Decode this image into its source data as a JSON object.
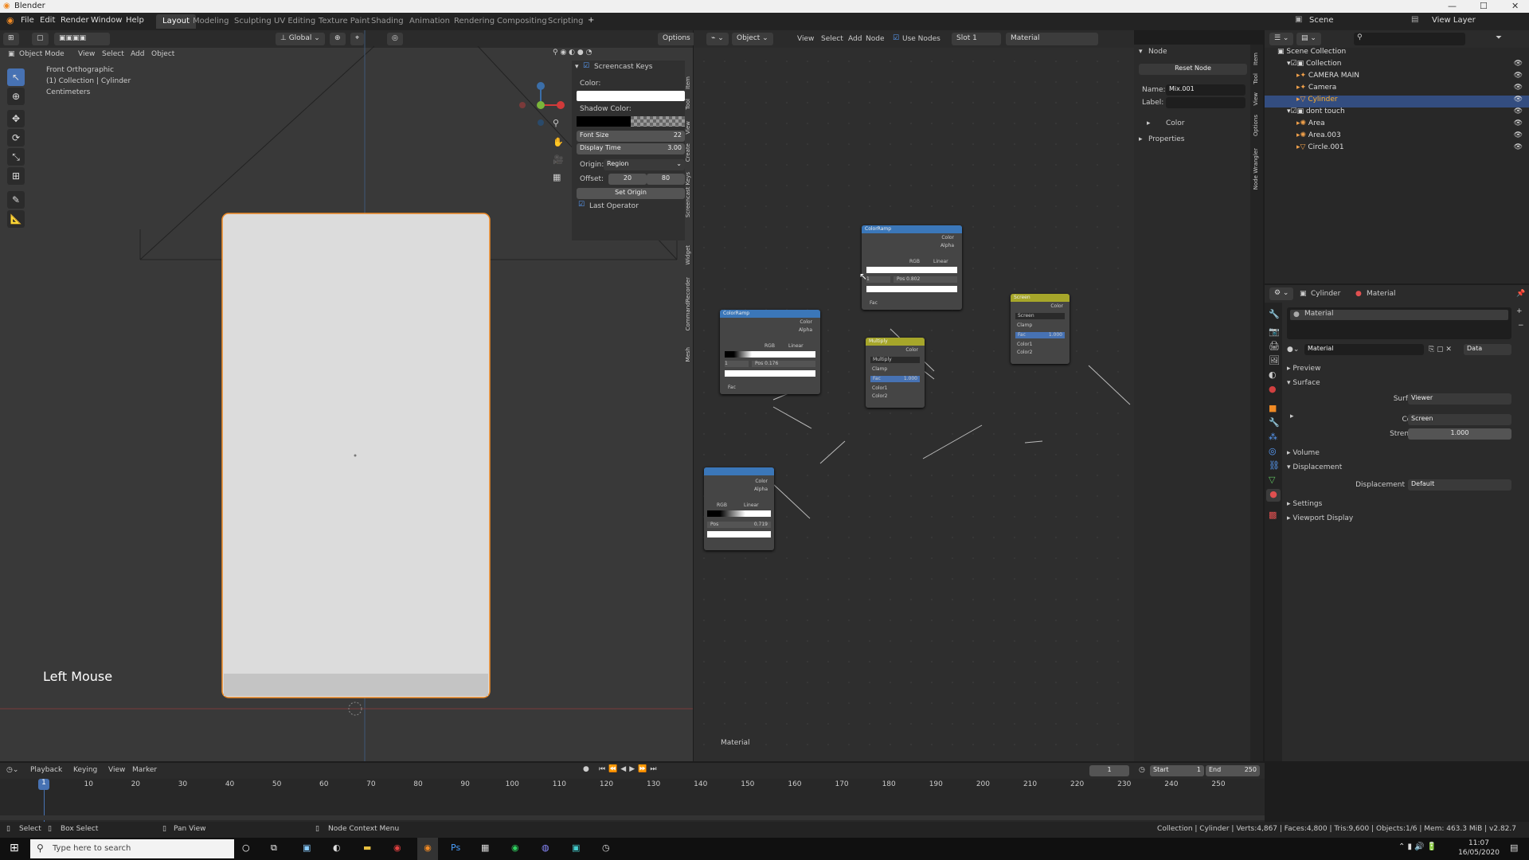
{
  "window": {
    "title": "Blender",
    "minimize": "—",
    "maximize": "☐",
    "close": "✕"
  },
  "menu": {
    "items": [
      "File",
      "Edit",
      "Render",
      "Window",
      "Help"
    ],
    "workspaces": [
      "Layout",
      "Modeling",
      "Sculpting",
      "UV Editing",
      "Texture Paint",
      "Shading",
      "Animation",
      "Rendering",
      "Compositing",
      "Scripting"
    ],
    "add": "+",
    "scene": "Scene",
    "view_layer": "View Layer"
  },
  "viewport": {
    "mode": "Object Mode",
    "menus": [
      "View",
      "Select",
      "Add",
      "Object"
    ],
    "orientation": "Global",
    "options": "Options",
    "info": [
      "Front Orthographic",
      "(1) Collection | Cylinder",
      "Centimeters"
    ],
    "overlay_text": "Left Mouse"
  },
  "screencast": {
    "title": "Screencast Keys",
    "color_label": "Color:",
    "shadow_label": "Shadow Color:",
    "font_size_label": "Font Size",
    "font_size": "22",
    "display_time_label": "Display Time",
    "display_time": "3.00",
    "origin_label": "Origin:",
    "origin": "Region",
    "offset_label": "Offset:",
    "offset_x": "20",
    "offset_y": "80",
    "set_origin": "Set Origin",
    "last_operator": "Last Operator"
  },
  "sidebar_tabs_vp": [
    "Item",
    "Tool",
    "View",
    "Create",
    "Screencast Keys",
    "Widget",
    "CommandRecorder",
    "Mesh"
  ],
  "node_editor": {
    "menus": [
      "Object",
      "View",
      "Select",
      "Add",
      "Node"
    ],
    "use_nodes": "Use Nodes",
    "slot": "Slot 1",
    "material": "Material",
    "footer": "Material",
    "nodes": {
      "cr1": {
        "title": "ColorRamp",
        "out": [
          "Color",
          "Alpha"
        ],
        "mode": "RGB",
        "interp": "Linear",
        "idx": "1",
        "pos_label": "Pos",
        "pos": "0.802",
        "fac": "Fac"
      },
      "cr2": {
        "title": "ColorRamp",
        "out": [
          "Color",
          "Alpha"
        ],
        "mode": "RGB",
        "interp": "Linear",
        "idx": "1",
        "pos_label": "Pos",
        "pos": "0.176",
        "fac": "Fac"
      },
      "cr3": {
        "out": [
          "Color",
          "Alpha"
        ],
        "mode": "RGB",
        "interp": "Linear",
        "pos_label": "Pos",
        "pos": "0.719"
      },
      "mul": {
        "title": "Multiply",
        "out": "Color",
        "mode": "Multiply",
        "clamp": "Clamp",
        "fac_label": "Fac",
        "fac": "1.000",
        "in": [
          "Color1",
          "Color2"
        ]
      },
      "scr": {
        "title": "Screen",
        "out": "Color",
        "mode": "Screen",
        "clamp": "Clamp",
        "fac_label": "Fac",
        "fac": "1.000",
        "in": [
          "Color1",
          "Color2"
        ]
      }
    }
  },
  "npanel": {
    "section": "Node",
    "reset": "Reset Node",
    "name_label": "Name:",
    "name": "Mix.001",
    "label_label": "Label:",
    "color": "Color",
    "properties": "Properties"
  },
  "npanel_tabs": [
    "Item",
    "Tool",
    "View",
    "Options",
    "Node Wrangler"
  ],
  "outliner": {
    "search_placeholder": "",
    "items": [
      {
        "label": "Scene Collection",
        "depth": 0
      },
      {
        "label": "Collection",
        "depth": 1
      },
      {
        "label": "CAMERA MAIN",
        "depth": 2
      },
      {
        "label": "Camera",
        "depth": 2
      },
      {
        "label": "Cylinder",
        "depth": 2,
        "selected": true
      },
      {
        "label": "dont touch",
        "depth": 1
      },
      {
        "label": "Area",
        "depth": 2
      },
      {
        "label": "Area.003",
        "depth": 2
      },
      {
        "label": "Circle.001",
        "depth": 2
      }
    ]
  },
  "properties": {
    "object": "Cylinder",
    "material_tab": "Material",
    "slot": "Material",
    "mat_name": "Material",
    "data": "Data",
    "sections": {
      "preview": "Preview",
      "surface": "Surface",
      "volume": "Volume",
      "displacement": "Displacement",
      "settings": "Settings",
      "viewport_display": "Viewport Display"
    },
    "surface_label": "Surface",
    "surface_value": "Viewer",
    "color_label": "Color",
    "color_value": "Screen",
    "strength_label": "Strength",
    "strength_value": "1.000",
    "disp_label": "Displacement",
    "disp_value": "Default"
  },
  "timeline": {
    "menus": [
      "Playback",
      "Keying",
      "View",
      "Marker"
    ],
    "current": "1",
    "start_label": "Start",
    "start": "1",
    "end_label": "End",
    "end": "250",
    "ticks": [
      "1",
      "10",
      "20",
      "30",
      "40",
      "50",
      "60",
      "70",
      "80",
      "90",
      "100",
      "110",
      "120",
      "130",
      "140",
      "150",
      "160",
      "170",
      "180",
      "190",
      "200",
      "210",
      "220",
      "230",
      "240",
      "250"
    ]
  },
  "status": {
    "left": [
      "Select",
      "Box Select",
      "Pan View",
      "Node Context Menu"
    ],
    "right": "Collection | Cylinder | Verts:4,867 | Faces:4,800 | Tris:9,600 | Objects:1/6 | Mem: 463.3 MiB | v2.82.7"
  },
  "taskbar": {
    "search": "Type here to search",
    "time": "11:07",
    "date": "16/05/2020"
  },
  "colors": {
    "accent": "#4772b3",
    "orange": "#f08a24",
    "node_blue": "#3b77b9",
    "node_yellow": "#a6a62a"
  }
}
